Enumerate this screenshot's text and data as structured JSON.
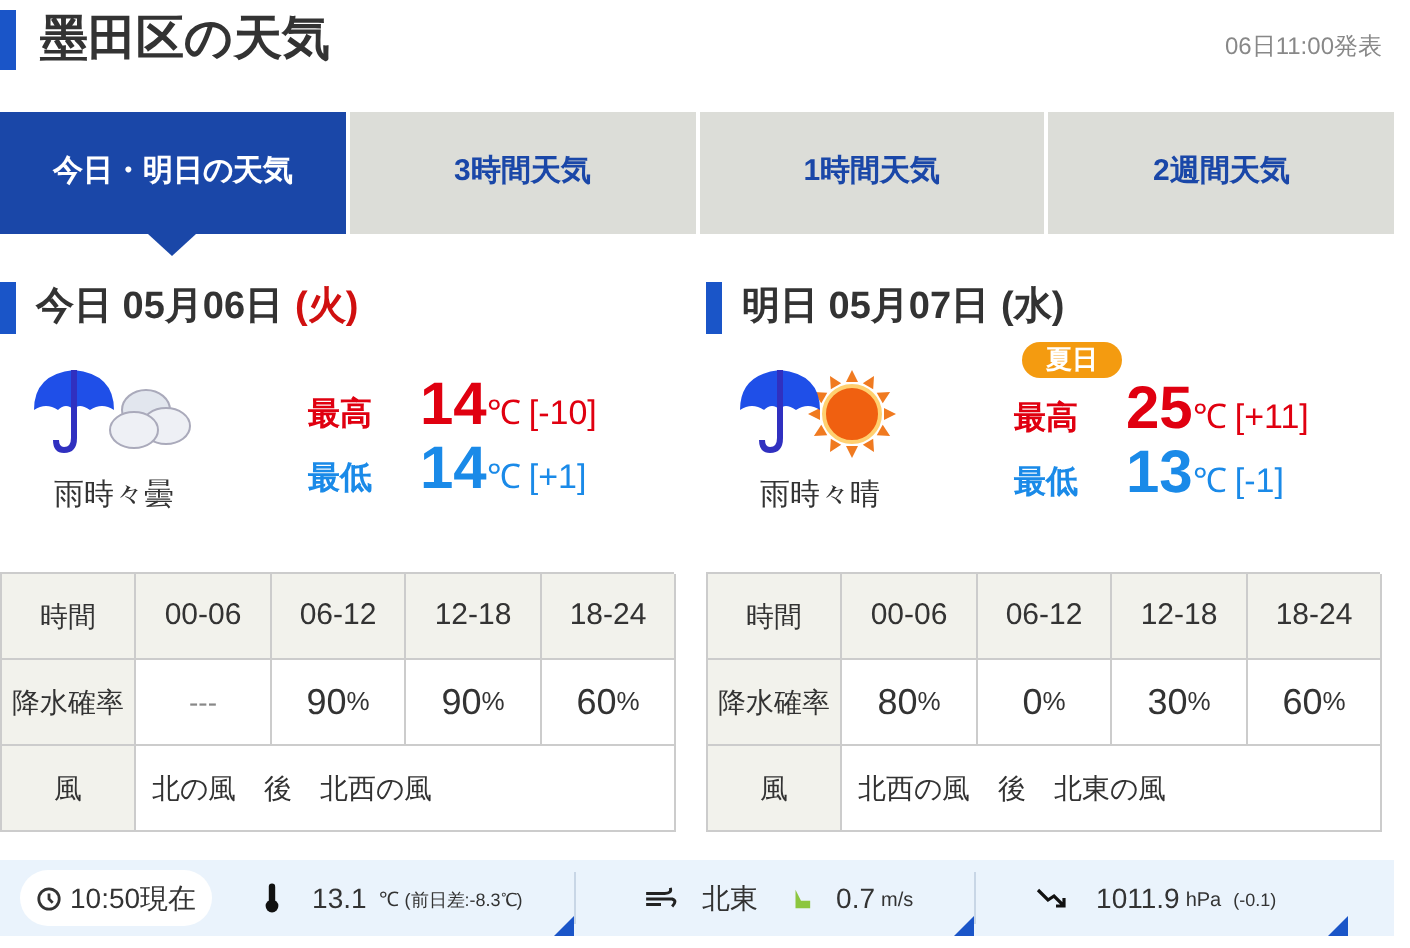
{
  "header": {
    "title": "墨田区の天気",
    "issued": "06日11:00発表"
  },
  "tabs": [
    {
      "label": "今日・明日の天気",
      "selected": true
    },
    {
      "label": "3時間天気",
      "selected": false
    },
    {
      "label": "1時間天気",
      "selected": false
    },
    {
      "label": "2週間天気",
      "selected": false
    }
  ],
  "days": [
    {
      "heading": "今日 05月06日",
      "weekday": "(火)",
      "holiday": true,
      "kind": "rain_then_cloudy",
      "weather_text": "雨時々曇",
      "high": {
        "label": "最高",
        "value": "14",
        "unit": "℃",
        "diff": "[-10]"
      },
      "low": {
        "label": "最低",
        "value": "14",
        "unit": "℃",
        "diff": "[+1]"
      },
      "table": {
        "time_label": "時間",
        "slots": [
          "00-06",
          "06-12",
          "12-18",
          "18-24"
        ],
        "rain_label": "降水確率",
        "rain": [
          {
            "value": "---"
          },
          {
            "value": "90",
            "unit": "%"
          },
          {
            "value": "90",
            "unit": "%"
          },
          {
            "value": "60",
            "unit": "%"
          }
        ],
        "wind_label": "風",
        "wind": "北の風　後　北西の風"
      }
    },
    {
      "heading": "明日 05月07日",
      "weekday": "(水)",
      "holiday": false,
      "kind": "rain_then_sunny",
      "weather_text": "雨時々晴",
      "badge": "夏日",
      "high": {
        "label": "最高",
        "value": "25",
        "unit": "℃",
        "diff": "[+11]"
      },
      "low": {
        "label": "最低",
        "value": "13",
        "unit": "℃",
        "diff": "[-1]"
      },
      "table": {
        "time_label": "時間",
        "slots": [
          "00-06",
          "06-12",
          "12-18",
          "18-24"
        ],
        "rain_label": "降水確率",
        "rain": [
          {
            "value": "80",
            "unit": "%"
          },
          {
            "value": "0",
            "unit": "%"
          },
          {
            "value": "30",
            "unit": "%"
          },
          {
            "value": "60",
            "unit": "%"
          }
        ],
        "wind_label": "風",
        "wind": "北西の風　後　北東の風"
      }
    }
  ],
  "current": {
    "time": "10:50現在",
    "temp": "13.1",
    "temp_unit": "℃",
    "temp_note": "(前日差:-8.3℃)",
    "wind_dir": "北東",
    "wind_speed": "0.7",
    "wind_unit": "m/s",
    "pressure": "1011.9",
    "pressure_unit": "hPa",
    "pressure_change": "(-0.1)"
  }
}
